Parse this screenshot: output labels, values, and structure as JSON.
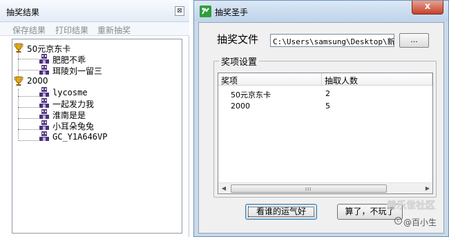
{
  "left": {
    "title": "抽奖结果",
    "close_glyph": "⊠",
    "toolbar": {
      "save": "保存结果",
      "print": "打印结果",
      "redraw": "重新抽奖"
    },
    "tree": [
      {
        "label": "50元京东卡",
        "icon": "trophy-icon",
        "children": [
          "肥肥不乖",
          "珥陵刘一留三"
        ]
      },
      {
        "label": "2000",
        "icon": "trophy-icon",
        "children": [
          "lycosme",
          "一起发力我",
          "淮南是是",
          "小耳朵兔兔",
          "GC_Y1A646VP"
        ]
      }
    ]
  },
  "window": {
    "title": "抽奖圣手",
    "close_glyph": "x",
    "file_label": "抽奖文件",
    "file_path": "C:\\Users\\samsung\\Desktop\\新建",
    "browse_label": "...",
    "group_title": "奖项设置",
    "columns": [
      "奖项",
      "抽取人数"
    ],
    "rows": [
      {
        "prize": "50元京东卡",
        "count": "2"
      },
      {
        "prize": "2000",
        "count": "5"
      }
    ],
    "scroll_grip": "III",
    "btn_lucky": "看谁的运气好",
    "btn_cancel": "算了，不玩了"
  },
  "watermark": {
    "text": "善乐世社区",
    "handle": "@百小生",
    "circle": "c"
  }
}
